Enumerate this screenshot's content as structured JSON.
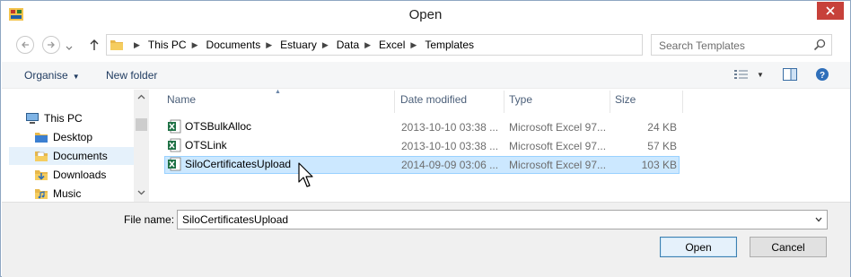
{
  "window": {
    "title": "Open"
  },
  "address": {
    "crumbs": [
      "This PC",
      "Documents",
      "Estuary",
      "Data",
      "Excel",
      "Templates"
    ]
  },
  "search": {
    "placeholder": "Search Templates"
  },
  "toolbar": {
    "organise_label": "Organise",
    "new_folder_label": "New folder"
  },
  "sidebar": {
    "items": [
      {
        "label": "This PC",
        "icon": "computer-icon"
      },
      {
        "label": "Desktop",
        "icon": "folder-icon"
      },
      {
        "label": "Documents",
        "icon": "documents-folder-icon",
        "selected": true
      },
      {
        "label": "Downloads",
        "icon": "downloads-folder-icon"
      },
      {
        "label": "Music",
        "icon": "music-folder-icon"
      }
    ]
  },
  "columns": {
    "name": "Name",
    "date": "Date modified",
    "type": "Type",
    "size": "Size"
  },
  "files": [
    {
      "name": "OTSBulkAlloc",
      "date": "2013-10-10 03:38 ...",
      "type": "Microsoft Excel 97...",
      "size": "24 KB",
      "selected": false
    },
    {
      "name": "OTSLink",
      "date": "2013-10-10 03:38 ...",
      "type": "Microsoft Excel 97...",
      "size": "57 KB",
      "selected": false
    },
    {
      "name": "SiloCertificatesUpload",
      "date": "2014-09-09 03:06 ...",
      "type": "Microsoft Excel 97...",
      "size": "103 KB",
      "selected": true
    }
  ],
  "filename": {
    "label": "File name:",
    "value": "SiloCertificatesUpload"
  },
  "buttons": {
    "open": "Open",
    "cancel": "Cancel"
  },
  "colors": {
    "close": "#c7413a",
    "selection": "#cce8ff",
    "excel": "#1e7145"
  }
}
